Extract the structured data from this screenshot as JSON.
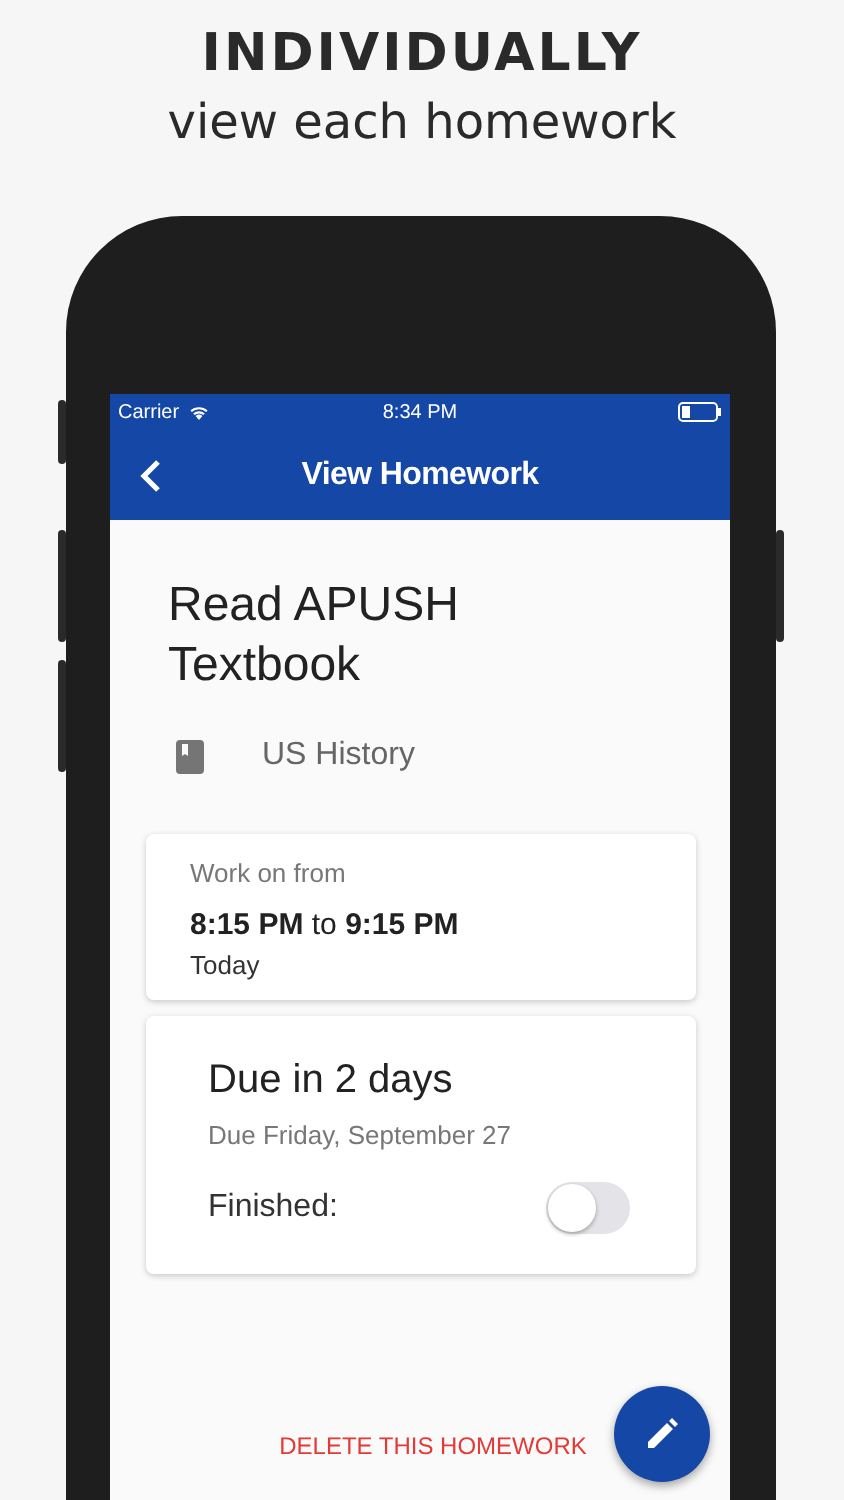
{
  "header": {
    "title": "INDIVIDUALLY",
    "subtitle": "view each homework"
  },
  "status_bar": {
    "carrier": "Carrier",
    "time": "8:34 PM"
  },
  "nav_bar": {
    "title": "View Homework"
  },
  "homework": {
    "title": "Read APUSH Textbook",
    "subject": "US History"
  },
  "work_card": {
    "label": "Work on from",
    "time": "**8:15 PM** to **9:15 PM**",
    "day": "Today"
  },
  "due_card": {
    "title": "Due in 2 days",
    "date": "Due Friday, September 27",
    "finished_label": "Finished:",
    "finished": false
  },
  "delete_button": "DELETE THIS HOMEWORK"
}
